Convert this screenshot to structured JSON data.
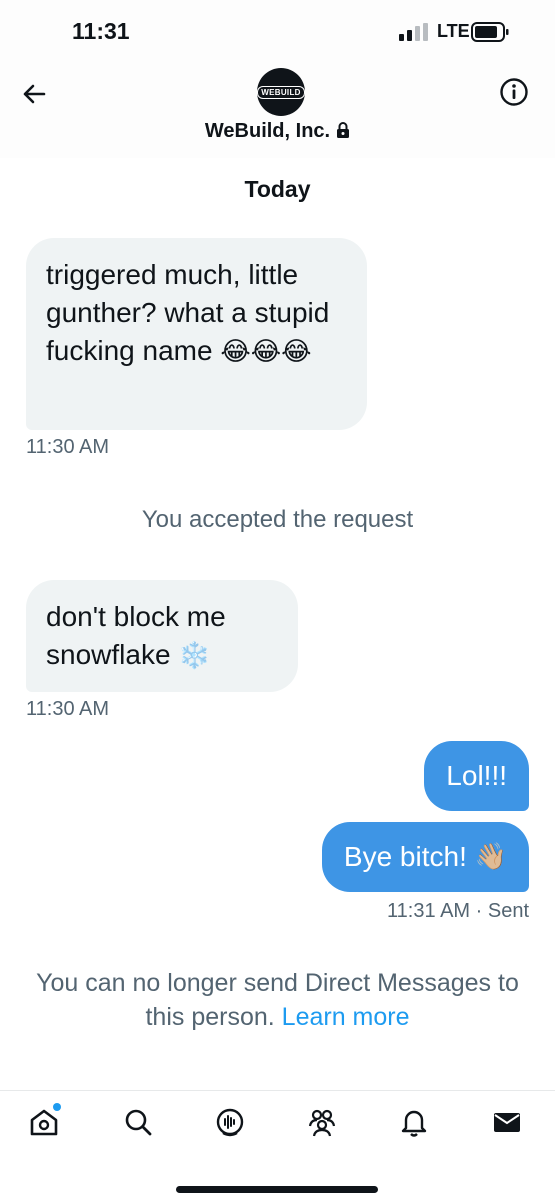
{
  "status_bar": {
    "time": "11:31",
    "network": "LTE"
  },
  "header": {
    "avatar_text": "WEBUILD",
    "name": "WeBuild, Inc."
  },
  "date_separator": "Today",
  "messages": [
    {
      "direction": "in",
      "text": "triggered much, little gunther? what a stupid fucking name",
      "emoji": "😂😂😂",
      "time": "11:30 AM"
    },
    {
      "direction": "in",
      "text": "don't block me snowflake",
      "emoji": "❄️",
      "time": "11:30 AM"
    },
    {
      "direction": "out",
      "text": "Lol!!!"
    },
    {
      "direction": "out",
      "text": "Bye bitch!",
      "emoji": "👋🏼",
      "time": "11:31 AM",
      "status": "· Sent"
    }
  ],
  "system_note": "You accepted the request",
  "blocked_notice": {
    "text": "You can no longer send Direct Messages to this person.",
    "link": "Learn more"
  },
  "tab_bar": {
    "icons": [
      "home-icon",
      "search-icon",
      "spaces-icon",
      "communities-icon",
      "notifications-icon",
      "messages-icon"
    ]
  },
  "colors": {
    "accent": "#1d9bf0",
    "outgoing_bubble": "#3e95e5",
    "incoming_bubble": "#eff3f4",
    "muted_text": "#536471"
  }
}
